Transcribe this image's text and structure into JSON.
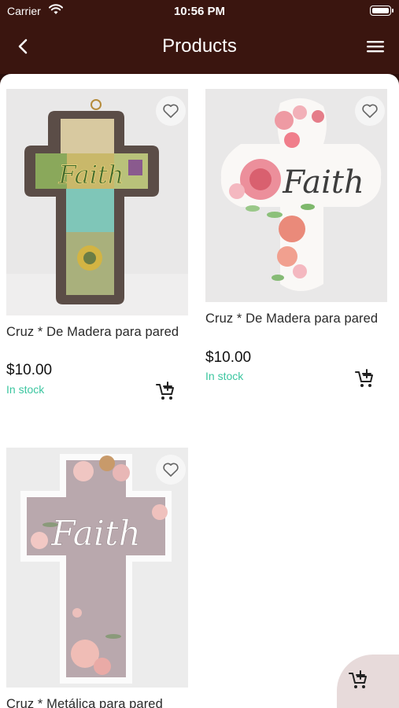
{
  "status_bar": {
    "carrier": "Carrier",
    "time": "10:56 PM"
  },
  "nav": {
    "title": "Products"
  },
  "products": [
    {
      "name": "Cruz * De Madera para pared",
      "price": "$10.00",
      "stock": "In stock",
      "image_word": "Faith"
    },
    {
      "name": "Cruz * De Madera para pared",
      "price": "$10.00",
      "stock": "In stock",
      "image_word": "Faith"
    },
    {
      "name": "Cruz * Metálica para pared",
      "image_word": "Faith"
    }
  ],
  "colors": {
    "header": "#3a150f",
    "stock": "#3cc6a0",
    "image_bg": "#e9e8e8",
    "floating_cart_bg": "#e7dada"
  },
  "icons": [
    "wifi-icon",
    "battery-icon",
    "back-arrow-icon",
    "hamburger-menu-icon",
    "heart-icon",
    "add-to-cart-icon"
  ]
}
